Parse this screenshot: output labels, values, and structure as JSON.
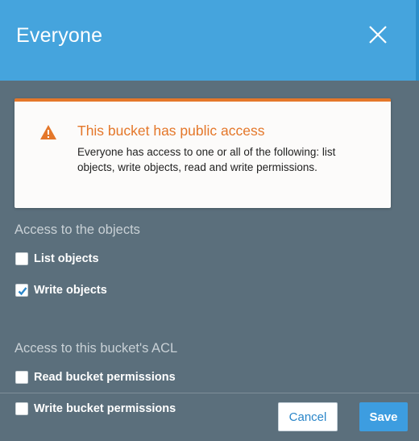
{
  "dialog": {
    "title": "Everyone",
    "close_icon": "close-icon"
  },
  "alert": {
    "title": "This bucket has public access",
    "body": "Everyone has access to one or all of the following: list objects, write objects, read and write permissions.",
    "icon": "warning-icon",
    "accent_color": "#e4772a"
  },
  "objects_access": {
    "label": "Access to the objects",
    "options": [
      {
        "label": "List objects",
        "checked": false
      },
      {
        "label": "Write objects",
        "checked": true
      }
    ]
  },
  "acl_access": {
    "label": "Access to this bucket's ACL",
    "options": [
      {
        "label": "Read bucket permissions",
        "checked": false
      },
      {
        "label": "Write bucket permissions",
        "checked": false
      }
    ]
  },
  "footer": {
    "cancel_label": "Cancel",
    "save_label": "Save"
  },
  "colors": {
    "header": "#45a4dd",
    "body": "#5b6f7c",
    "primary_button": "#3d9de0"
  }
}
